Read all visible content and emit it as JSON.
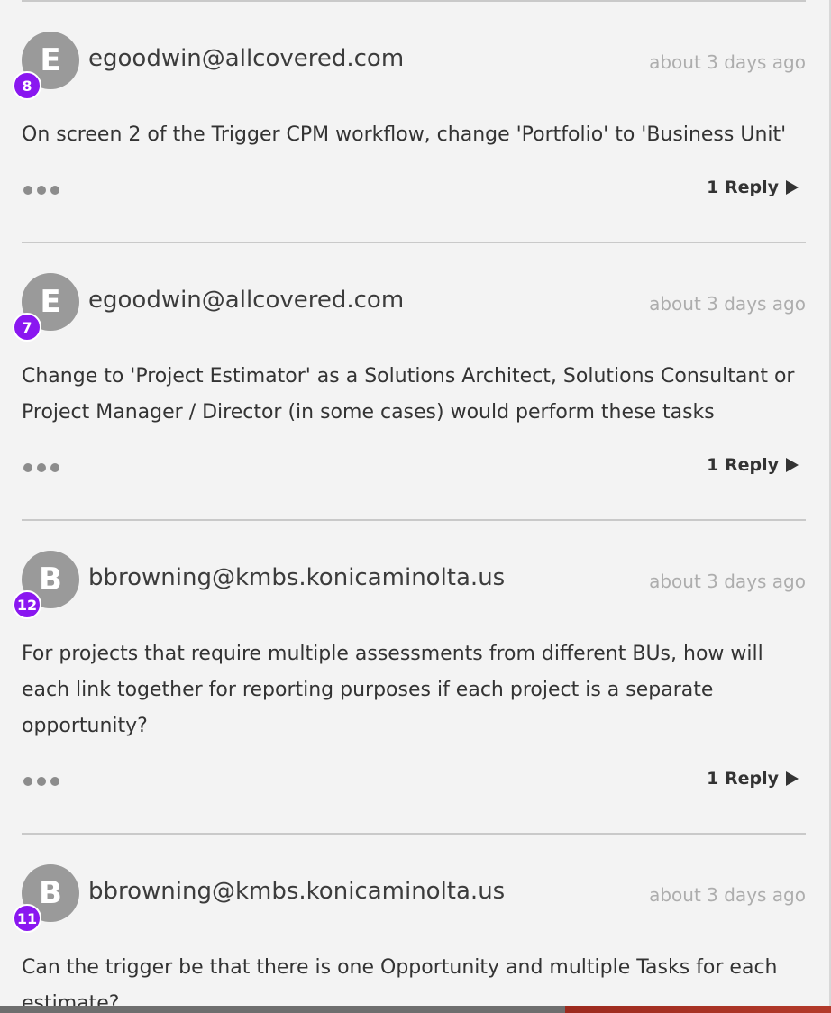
{
  "comments": [
    {
      "avatar_letter": "E",
      "badge": "8",
      "author": "egoodwin@allcovered.com",
      "time": "about 3 days ago",
      "text": "On screen 2 of the Trigger CPM workflow, change 'Portfolio' to 'Business Unit'",
      "reply_label": "1 Reply"
    },
    {
      "avatar_letter": "E",
      "badge": "7",
      "author": "egoodwin@allcovered.com",
      "time": "about 3 days ago",
      "text": "Change to 'Project Estimator' as a Solutions Architect, Solutions Consultant or Project Manager / Director (in some cases) would perform these tasks",
      "reply_label": "1 Reply"
    },
    {
      "avatar_letter": "B",
      "badge": "12",
      "author": "bbrowning@kmbs.konicaminolta.us",
      "time": "about 3 days ago",
      "text": "For projects that require multiple assessments from different BUs, how will each link together for reporting purposes if each project is a separate opportunity?",
      "reply_label": "1 Reply"
    },
    {
      "avatar_letter": "B",
      "badge": "11",
      "author": "bbrowning@kmbs.konicaminolta.us",
      "time": "about 3 days ago",
      "text": "Can the trigger be that there is one Opportunity and multiple Tasks for each estimate?"
    }
  ],
  "icons": {
    "more": "more-options-icon",
    "reply_arrow": "play-arrow-icon"
  },
  "colors": {
    "badge": "#8a17f0",
    "avatar": "#9a9a9a",
    "timestamp": "#adadad"
  }
}
